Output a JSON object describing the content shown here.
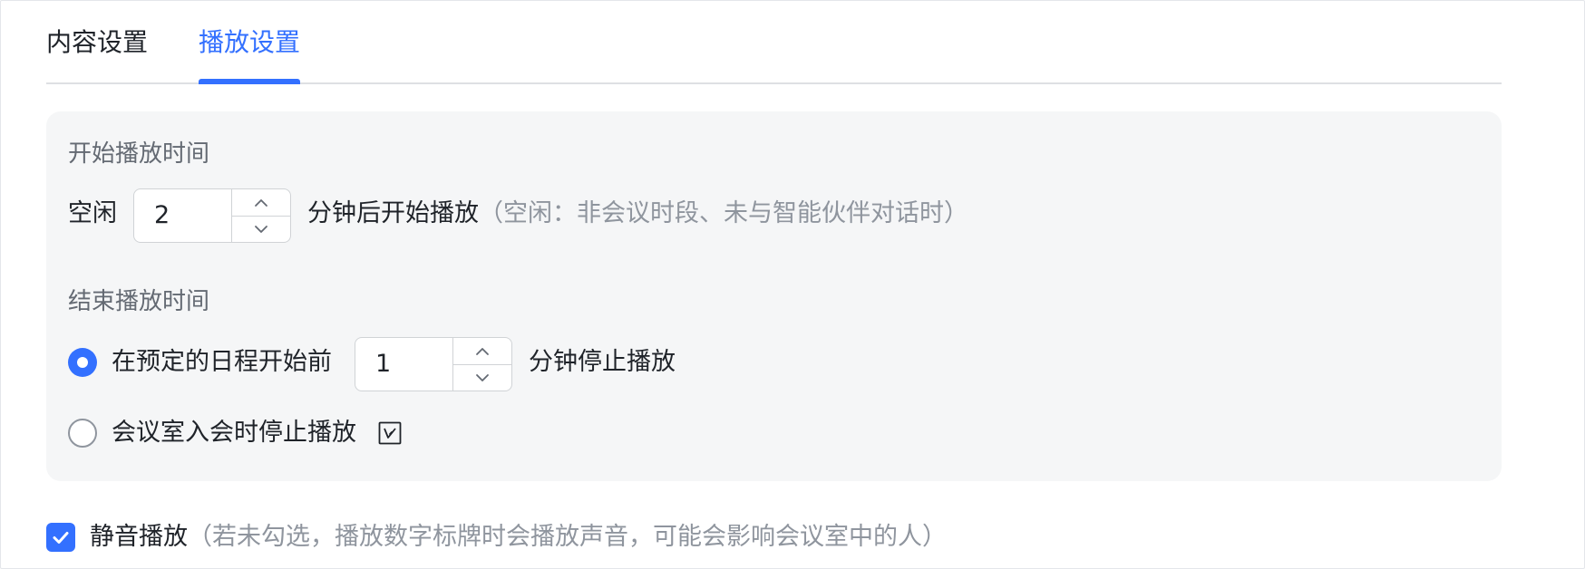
{
  "tabs": [
    {
      "label": "内容设置",
      "active": false
    },
    {
      "label": "播放设置",
      "active": true
    }
  ],
  "start": {
    "title": "开始播放时间",
    "prefix": "空闲",
    "value": "2",
    "suffix": "分钟后开始播放",
    "hint": "（空闲：非会议时段、未与智能伙伴对话时）"
  },
  "end": {
    "title": "结束播放时间",
    "option1": {
      "label": "在预定的日程开始前",
      "value": "1",
      "suffix": "分钟停止播放",
      "selected": true
    },
    "option2": {
      "label": "会议室入会时停止播放",
      "selected": false,
      "icon": "verify-icon"
    }
  },
  "mute": {
    "label": "静音播放",
    "hint": "（若未勾选，播放数字标牌时会播放声音，可能会影响会议室中的人）",
    "checked": true
  },
  "colors": {
    "accent": "#3370ff",
    "text": "#1f2329",
    "hint": "#8f959e",
    "panel": "#f5f6f7"
  }
}
